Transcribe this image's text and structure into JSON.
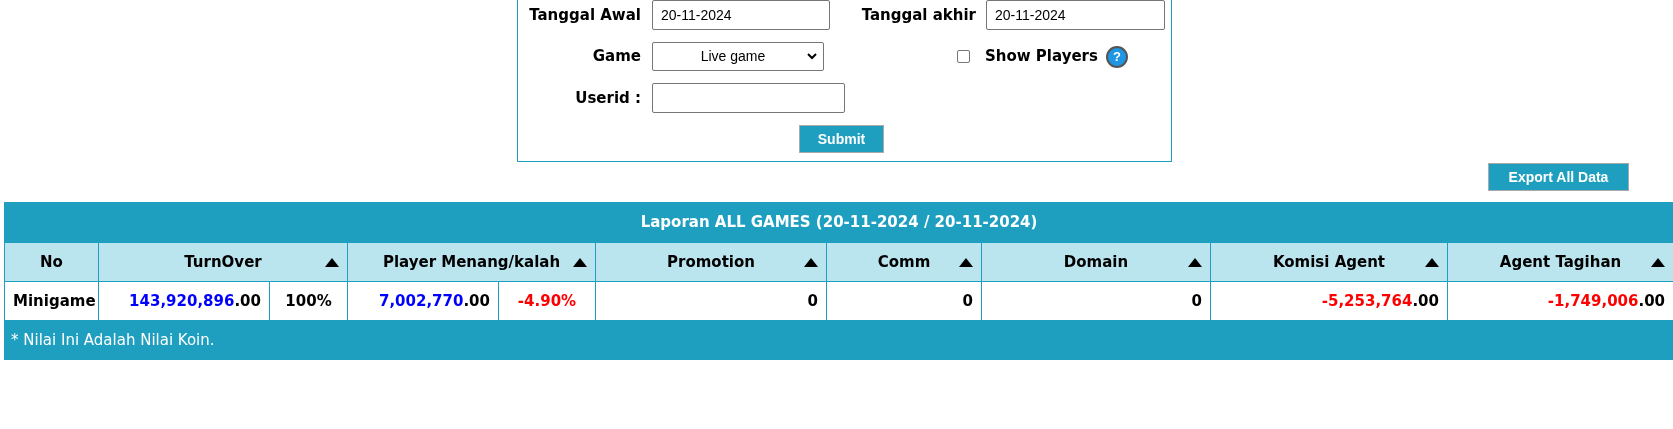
{
  "filter": {
    "start_date": {
      "label": "Tanggal Awal",
      "value": "20-11-2024"
    },
    "end_date": {
      "label": "Tanggal akhir",
      "value": "20-11-2024"
    },
    "game": {
      "label": "Game",
      "value": "Live game"
    },
    "show_players": {
      "label": "Show Players",
      "checked": false,
      "help": "?"
    },
    "userid": {
      "label": "Userid :"
    },
    "submit": "Submit"
  },
  "export_button": "Export All Data",
  "report": {
    "title": "Laporan ALL GAMES (20-11-2024 / 20-11-2024)",
    "columns": [
      {
        "label": "No",
        "sortable": false
      },
      {
        "label": "TurnOver",
        "sortable": true
      },
      {
        "label": "Player Menang/kalah",
        "sortable": true
      },
      {
        "label": "Promotion",
        "sortable": true
      },
      {
        "label": "Comm",
        "sortable": true
      },
      {
        "label": "Domain",
        "sortable": true
      },
      {
        "label": "Komisi Agent",
        "sortable": true
      },
      {
        "label": "Agent Tagihan",
        "sortable": true
      }
    ],
    "rows": [
      {
        "cells": [
          {
            "kind": "name",
            "text": "Minigame"
          },
          {
            "kind": "amount",
            "text": "143,920,896",
            "fraction": ".00",
            "color": "#0000ff",
            "share": {
              "text": "100%"
            }
          },
          {
            "kind": "amount",
            "text": "7,002,770",
            "fraction": ".00",
            "color": "#0000ff",
            "share": {
              "text": "-4.90%",
              "color": "#ff0000"
            }
          },
          {
            "kind": "amount",
            "text": "0"
          },
          {
            "kind": "amount",
            "text": "0"
          },
          {
            "kind": "amount",
            "text": "0"
          },
          {
            "kind": "amount",
            "text": "-5,253,764",
            "fraction": ".00",
            "color": "#ff0000"
          },
          {
            "kind": "amount",
            "text": "-1,749,006",
            "fraction": ".00",
            "color": "#ff0000"
          }
        ]
      }
    ],
    "note": "* Nilai Ini Adalah Nilai Koin."
  }
}
